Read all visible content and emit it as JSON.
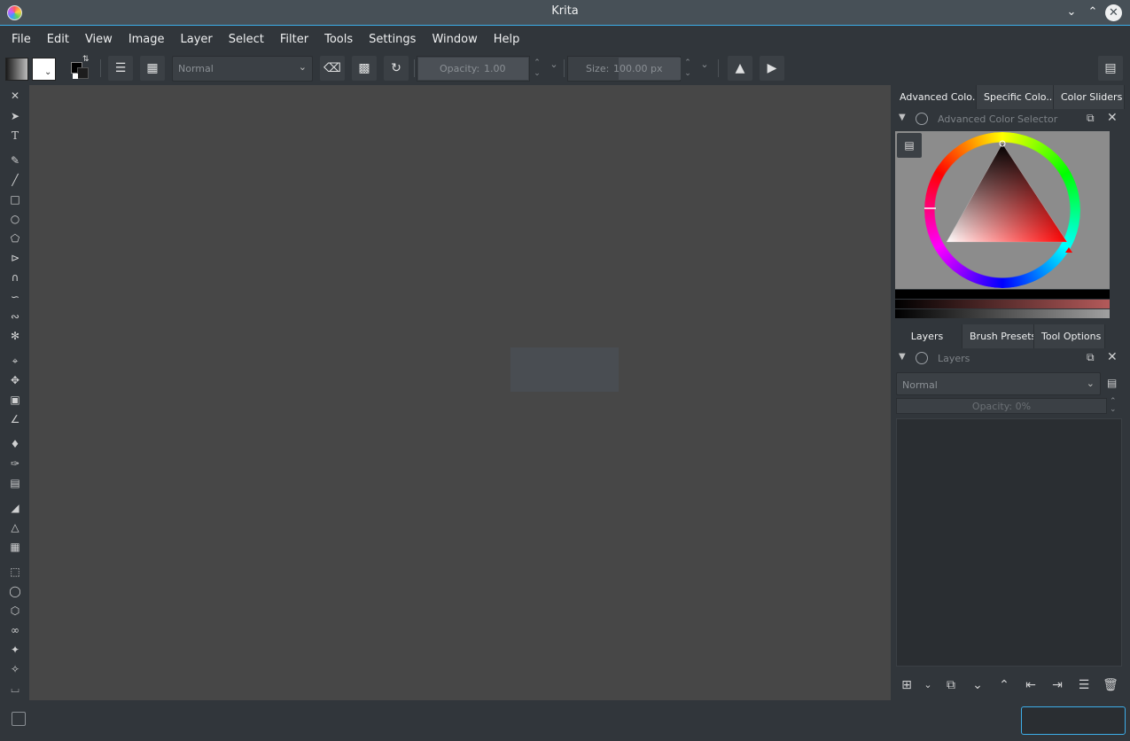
{
  "window": {
    "title": "Krita"
  },
  "menu": [
    "File",
    "Edit",
    "View",
    "Image",
    "Layer",
    "Select",
    "Filter",
    "Tools",
    "Settings",
    "Window",
    "Help"
  ],
  "toolbar": {
    "blend_mode": "Normal",
    "opacity_label": "Opacity:",
    "opacity_value": "1.00",
    "opacity_fraction": 1.0,
    "size_label": "Size:",
    "size_value": "100.00 px"
  },
  "dock": {
    "color_tabs": [
      "Advanced Colo...",
      "Specific Colo...",
      "Color Sliders"
    ],
    "color_docker_title": "Advanced Color Selector",
    "layer_tabs": [
      "Layers",
      "Brush Presets",
      "Tool Options"
    ],
    "layers_docker_title": "Layers",
    "layers_blend_mode": "Normal",
    "layers_opacity": "Opacity:  0%"
  },
  "colors": {
    "accent": "#3daee9",
    "foreground": "#000000",
    "background": "#ffffff",
    "selected_hue": "#ff0000"
  }
}
